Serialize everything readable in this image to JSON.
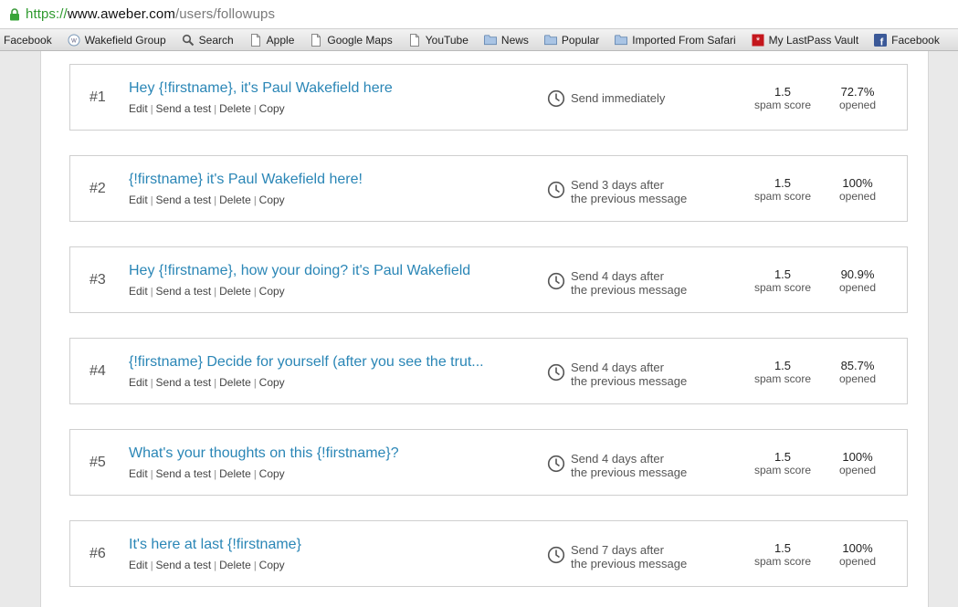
{
  "browser": {
    "url_scheme": "https://",
    "url_host": "www.aweber.com",
    "url_path": "/users/followups"
  },
  "bookmarks": [
    {
      "label": "Facebook",
      "icon": "none"
    },
    {
      "label": "Wakefield Group",
      "icon": "globe-icon"
    },
    {
      "label": "Search",
      "icon": "magnifier-icon"
    },
    {
      "label": "Apple",
      "icon": "page-icon"
    },
    {
      "label": "Google Maps",
      "icon": "page-icon"
    },
    {
      "label": "YouTube",
      "icon": "page-icon"
    },
    {
      "label": "News",
      "icon": "folder-icon"
    },
    {
      "label": "Popular",
      "icon": "folder-icon"
    },
    {
      "label": "Imported From Safari",
      "icon": "folder-icon"
    },
    {
      "label": "My LastPass Vault",
      "icon": "lastpass-icon"
    },
    {
      "label": "Facebook",
      "icon": "facebook-icon"
    }
  ],
  "actions": {
    "edit": "Edit",
    "send_test": "Send a test",
    "delete": "Delete",
    "copy": "Copy",
    "separator": "|"
  },
  "messages": [
    {
      "number": "#1",
      "subject": "Hey {!firstname}, it's Paul Wakefield here",
      "send_line1": "Send immediately",
      "send_line2": "",
      "spam_score": "1.5",
      "spam_label": "spam score",
      "opened": "72.7%",
      "opened_label": "opened"
    },
    {
      "number": "#2",
      "subject": "{!firstname} it's Paul Wakefield here!",
      "send_line1": "Send 3 days after",
      "send_line2": "the previous message",
      "spam_score": "1.5",
      "spam_label": "spam score",
      "opened": "100%",
      "opened_label": "opened"
    },
    {
      "number": "#3",
      "subject": "Hey {!firstname}, how your doing? it's Paul Wakefield",
      "send_line1": "Send 4 days after",
      "send_line2": "the previous message",
      "spam_score": "1.5",
      "spam_label": "spam score",
      "opened": "90.9%",
      "opened_label": "opened"
    },
    {
      "number": "#4",
      "subject": "{!firstname} Decide for yourself (after you see the trut...",
      "send_line1": "Send 4 days after",
      "send_line2": "the previous message",
      "spam_score": "1.5",
      "spam_label": "spam score",
      "opened": "85.7%",
      "opened_label": "opened"
    },
    {
      "number": "#5",
      "subject": "What's your thoughts on this {!firstname}?",
      "send_line1": "Send 4 days after",
      "send_line2": "the previous message",
      "spam_score": "1.5",
      "spam_label": "spam score",
      "opened": "100%",
      "opened_label": "opened"
    },
    {
      "number": "#6",
      "subject": "It's here at last {!firstname}",
      "send_line1": "Send 7 days after",
      "send_line2": "the previous message",
      "spam_score": "1.5",
      "spam_label": "spam score",
      "opened": "100%",
      "opened_label": "opened"
    }
  ],
  "colors": {
    "link": "#2a86b6",
    "secure": "#2f9a2f"
  }
}
